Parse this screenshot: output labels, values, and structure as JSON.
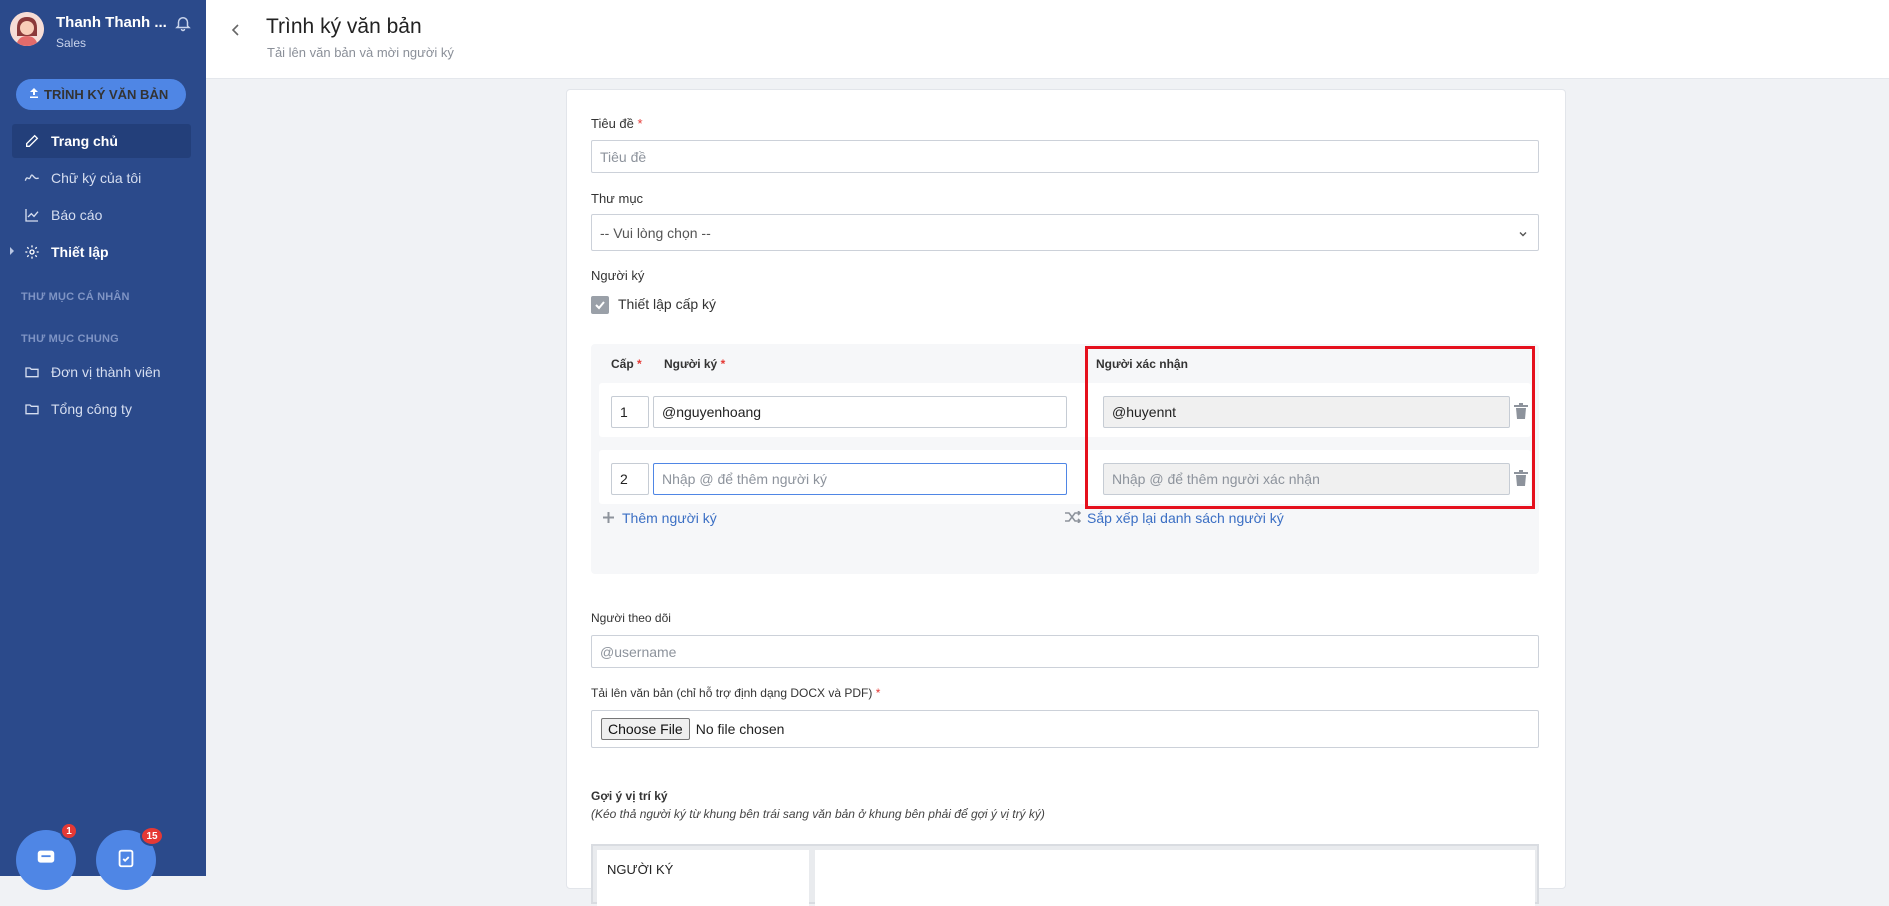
{
  "sidebar": {
    "user_name": "Thanh Thanh ...",
    "user_role": "Sales",
    "primary_action": "TRÌNH KÝ VĂN BẢN",
    "nav": [
      {
        "label": "Trang chủ",
        "icon": "pen-icon"
      },
      {
        "label": "Chữ ký của tôi",
        "icon": "signature-icon"
      },
      {
        "label": "Báo cáo",
        "icon": "chart-icon"
      },
      {
        "label": "Thiết lập",
        "icon": "gear-icon"
      }
    ],
    "section_personal": "THƯ MỤC CÁ NHÂN",
    "section_shared": "THƯ MỤC CHUNG",
    "folders": [
      {
        "label": "Đơn vị thành viên",
        "icon": "folder-icon"
      },
      {
        "label": "Tổng công ty",
        "icon": "folder-icon"
      }
    ],
    "chat_badge": "1",
    "task_badge": "15"
  },
  "header": {
    "title": "Trình ký văn bản",
    "subtitle": "Tải lên văn bản và mời người ký"
  },
  "form": {
    "title_label": "Tiêu đề",
    "title_placeholder": "Tiêu đề",
    "folder_label": "Thư mục",
    "folder_value": "-- Vui lòng chọn --",
    "signers_label": "Người ký",
    "signing_level_checkbox": "Thiết lập cấp ký",
    "col_level": "Cấp",
    "col_signer": "Người ký",
    "col_confirmer": "Người xác nhận",
    "rows": [
      {
        "level": "1",
        "signer": "@nguyenhoang",
        "signer_placeholder": "",
        "confirmer": "@huyennt",
        "confirmer_placeholder": ""
      },
      {
        "level": "2",
        "signer": "",
        "signer_placeholder": "Nhập @ để thêm người ký",
        "confirmer": "",
        "confirmer_placeholder": "Nhập @ để thêm người xác nhận"
      }
    ],
    "add_signer": "Thêm người ký",
    "reorder_signers": "Sắp xếp lại danh sách người ký",
    "watchers_label": "Người theo dõi",
    "watchers_placeholder": "@username",
    "upload_label": "Tải lên văn bản (chỉ hỗ trợ định dạng DOCX và PDF)",
    "choose_file": "Choose File",
    "no_file": "No file chosen",
    "position_label": "Gợi ý vị trí ký",
    "position_hint": "(Kéo thả người ký từ khung bên trái sang văn bản ở khung bên phải để gợi ý vị trý ký)",
    "signer_box_title": "NGƯỜI KÝ",
    "required_mark": "*"
  },
  "colors": {
    "sidebar": "#2b4a8b",
    "accent": "#4f86e5",
    "highlight": "#e5101d",
    "link": "#3b6fc4"
  }
}
